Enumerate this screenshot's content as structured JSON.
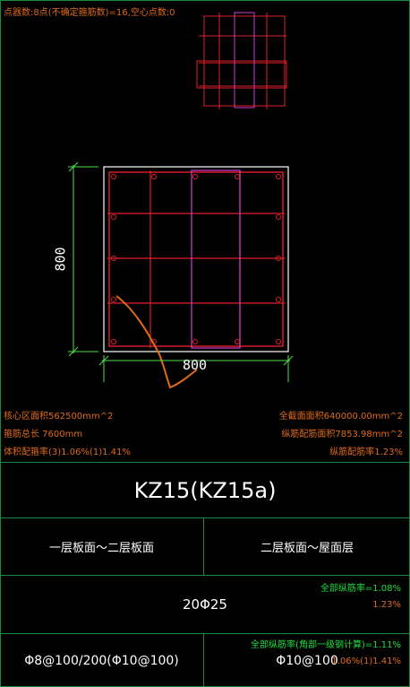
{
  "header": {
    "status_text": "点器数:8点(不确定箍筋数)=16,空心点数:0"
  },
  "dimensions": {
    "width_label": "800",
    "height_label": "800"
  },
  "stats": {
    "core_area": "核心区面积562500mm^2",
    "stirrup_length": "箍筋总长 7600mm",
    "stirrup_ratio": "体积配箍率(3)1.06%(1)1.41%",
    "full_section_area": "全截面面积640000.00mm^2",
    "longitudinal_area": "纵筋配筋面积7853.98mm^2",
    "longitudinal_ratio": "纵筋配筋率1.23%"
  },
  "table": {
    "title": "KZ15(KZ15a)",
    "floor_left": "一层板面～二层板面",
    "floor_right": "二层板面～屋面层",
    "longitudinal_bars": "20Φ25",
    "ratio_green": "全部纵筋率=1.08%",
    "ratio_orange": "1.23%",
    "stirrup_left": "Φ8@100/200(Φ10@100)",
    "stirrup_right": "Φ10@100",
    "stirrup_ratio_green": "全部纵筋率(角部一级钢计算)=1.11%",
    "stirrup_ratio_orange": "1.06%(1)1.41%"
  },
  "colors": {
    "frame_green": "#1c8a3c",
    "rebar_red": "#e0202a",
    "tie_magenta": "#d23cd2",
    "text_orange": "#e06a1a",
    "text_green": "#18e03c",
    "dim_green": "#4ce04c"
  }
}
